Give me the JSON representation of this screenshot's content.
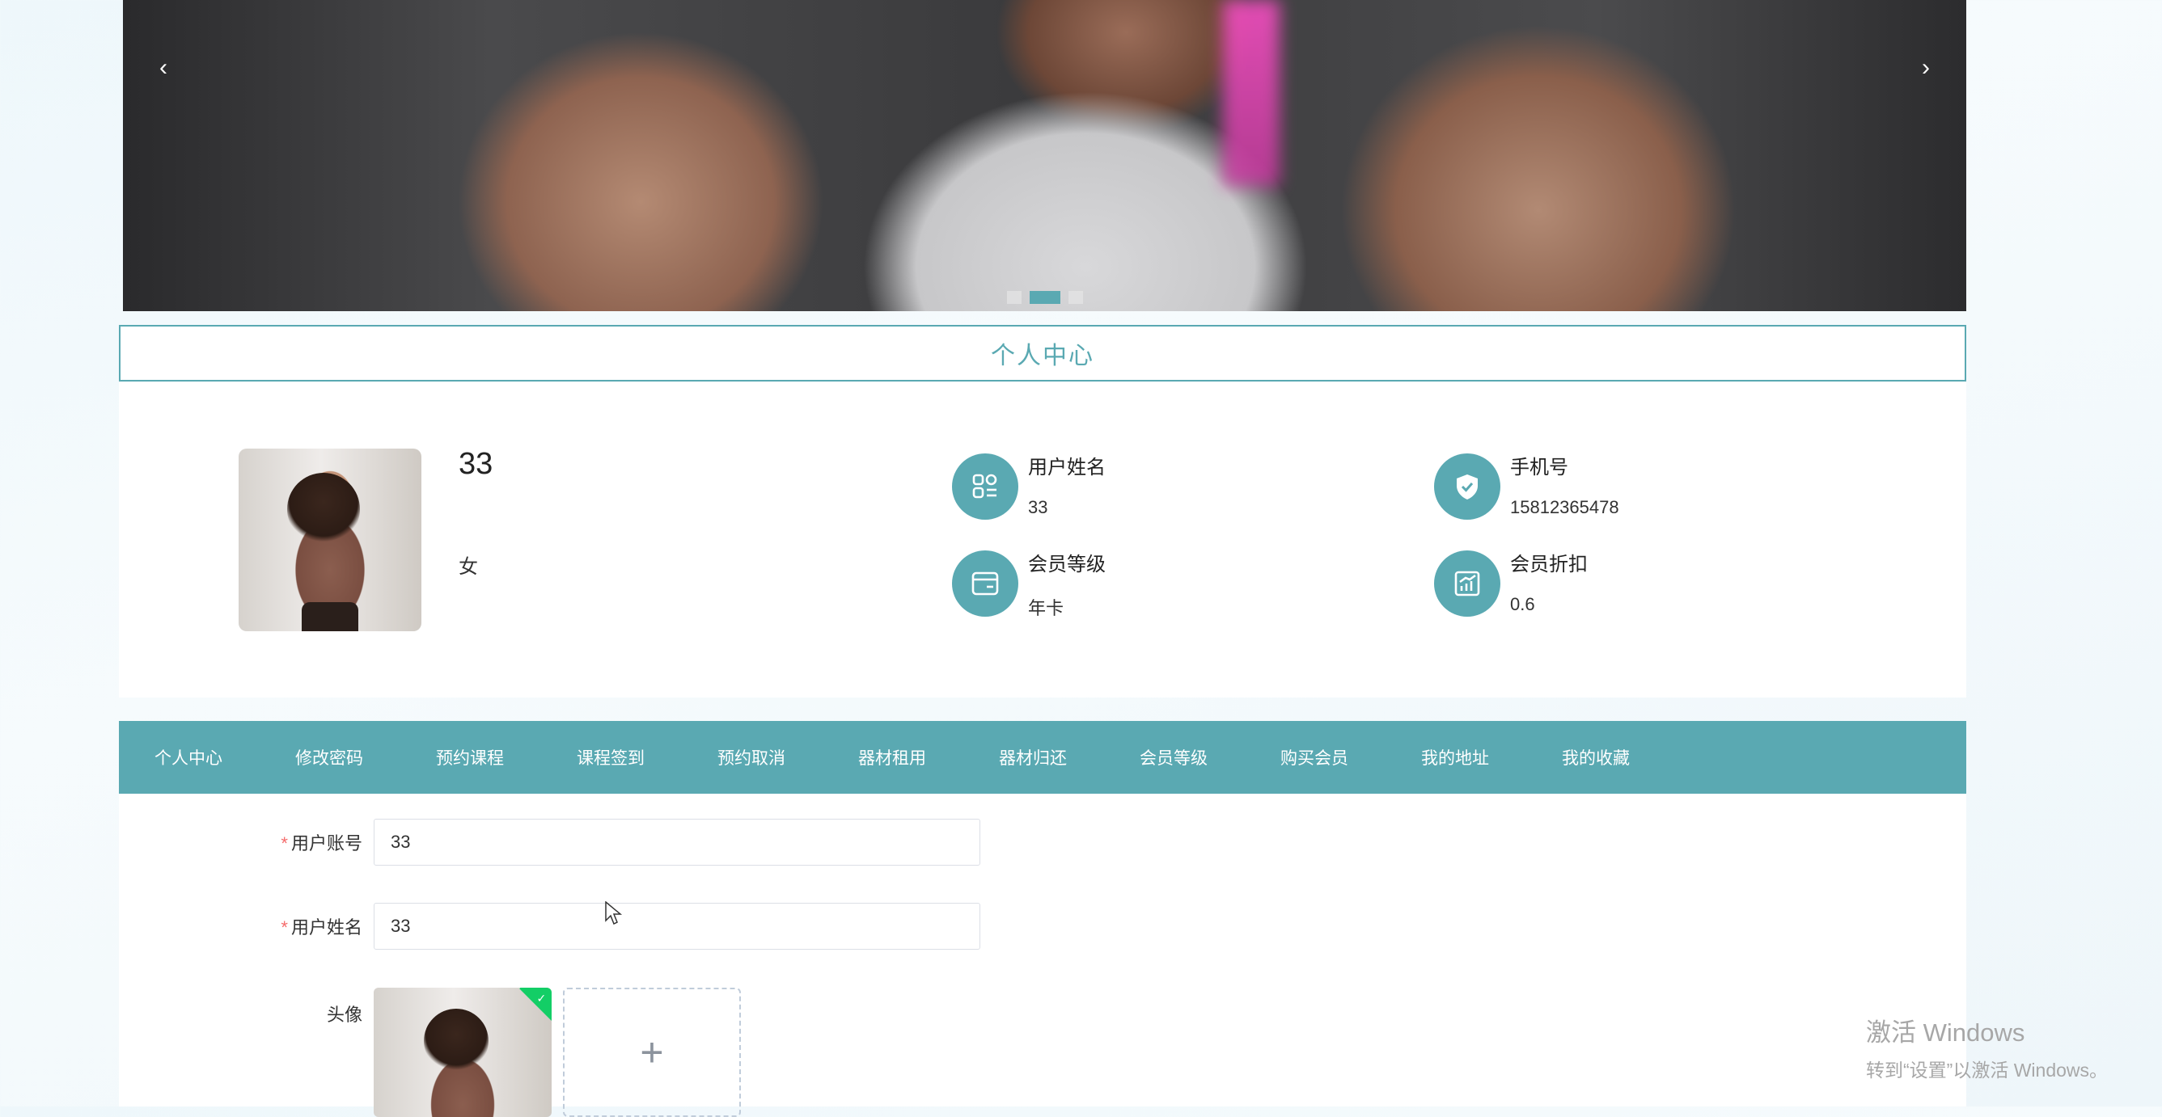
{
  "banner": {
    "prev_arrow": "‹",
    "next_arrow": "›",
    "dots": 3,
    "active_dot": 2
  },
  "section_title": "个人中心",
  "profile": {
    "name": "33",
    "sex": "女",
    "fields": [
      {
        "label": "用户姓名",
        "value": "33",
        "icon": "user-list-icon"
      },
      {
        "label": "手机号",
        "value": "15812365478",
        "icon": "shield-check-icon"
      },
      {
        "label": "会员等级",
        "value": "年卡",
        "icon": "card-icon"
      },
      {
        "label": "会员折扣",
        "value": "0.6",
        "icon": "chart-icon"
      }
    ]
  },
  "menu": [
    "个人中心",
    "修改密码",
    "预约课程",
    "课程签到",
    "预约取消",
    "器材租用",
    "器材归还",
    "会员等级",
    "购买会员",
    "我的地址",
    "我的收藏"
  ],
  "form": {
    "account": {
      "label": "用户账号",
      "value": "33"
    },
    "username": {
      "label": "用户姓名",
      "value": "33"
    },
    "avatar": {
      "label": "头像",
      "upload_symbol": "+"
    }
  },
  "watermark": {
    "line1": "激活 Windows",
    "line2": "转到“设置”以激活 Windows。"
  },
  "colors": {
    "primary": "#5aa9b2",
    "required": "#f56c6c",
    "success": "#13ce66"
  }
}
